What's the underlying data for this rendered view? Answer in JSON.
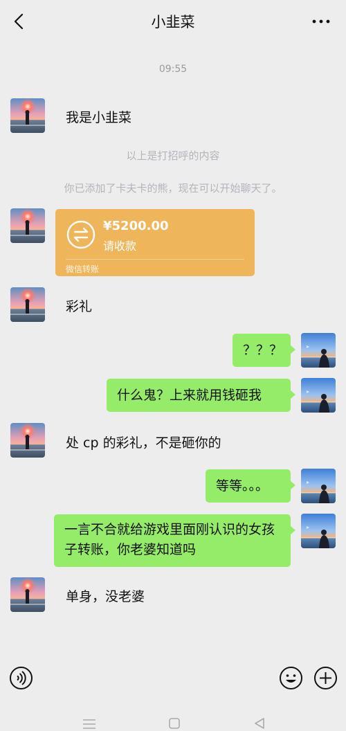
{
  "header": {
    "title": "小韭菜",
    "back_icon": "chevron-left-icon",
    "more_icon": "more-dots-icon"
  },
  "chat": {
    "timestamp": "09:55",
    "greeting": "我是小韭菜",
    "system_greeting_note": "以上是打招呼的内容",
    "system_added_note": "你已添加了卡夫卡的熊，现在可以开始聊天了。",
    "transfer": {
      "amount": "¥5200.00",
      "note": "请收款",
      "footer": "微信转账",
      "icon": "transfer-arrows-icon"
    },
    "messages": [
      {
        "side": "left",
        "text": "彩礼"
      },
      {
        "side": "right",
        "text": "？？？"
      },
      {
        "side": "right",
        "text": "什么鬼？上来就用钱砸我"
      },
      {
        "side": "left",
        "text": "处 cp 的彩礼，不是砸你的"
      },
      {
        "side": "right",
        "text": "等等。。。"
      },
      {
        "side": "right",
        "text": "一言不合就给游戏里面刚认识的女孩子转账，你老婆知道吗"
      },
      {
        "side": "left",
        "text": "单身，没老婆"
      }
    ]
  },
  "input_bar": {
    "voice_icon": "voice-icon",
    "emoji_icon": "emoji-icon",
    "plus_icon": "plus-icon"
  },
  "nav_bar": {
    "menu_icon": "menu-icon",
    "home_icon": "home-icon",
    "back_icon": "back-triangle-icon"
  },
  "colors": {
    "background": "#ededed",
    "my_bubble": "#95ec69",
    "transfer": "#efb55b"
  }
}
